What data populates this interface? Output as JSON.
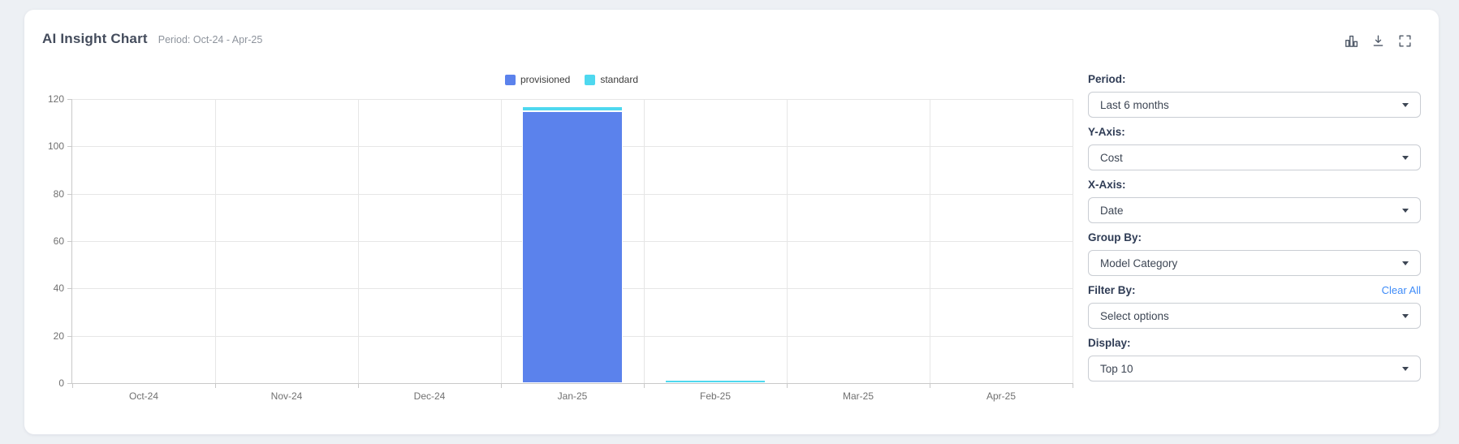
{
  "header": {
    "title": "AI Insight Chart",
    "period": "Period: Oct-24 - Apr-25"
  },
  "toolbar": {
    "icons": [
      "bar-chart-icon",
      "download-icon",
      "fullscreen-icon"
    ]
  },
  "chart_data": {
    "type": "bar",
    "stacked": true,
    "categories": [
      "Oct-24",
      "Nov-24",
      "Dec-24",
      "Jan-25",
      "Feb-25",
      "Mar-25",
      "Apr-25"
    ],
    "series": [
      {
        "name": "provisioned",
        "color": "#5b82ec",
        "values": [
          0,
          0,
          0,
          115,
          0,
          0,
          0
        ]
      },
      {
        "name": "standard",
        "color": "#4ed8ef",
        "values": [
          0,
          0,
          0,
          2,
          1.5,
          0,
          0
        ]
      }
    ],
    "ylim": [
      0,
      120
    ],
    "yticks": [
      0,
      20,
      40,
      60,
      80,
      100,
      120
    ],
    "grid": true,
    "legend_position": "top-center",
    "xlabel": "",
    "ylabel": ""
  },
  "controls": {
    "groups": [
      {
        "id": "period",
        "label": "Period:",
        "value": "Last 6 months"
      },
      {
        "id": "y-axis",
        "label": "Y-Axis:",
        "value": "Cost"
      },
      {
        "id": "x-axis",
        "label": "X-Axis:",
        "value": "Date"
      },
      {
        "id": "group-by",
        "label": "Group By:",
        "value": "Model Category"
      },
      {
        "id": "filter-by",
        "label": "Filter By:",
        "value": "Select options",
        "action": "Clear All"
      },
      {
        "id": "display",
        "label": "Display:",
        "value": "Top 10"
      }
    ]
  },
  "colors": {
    "provisioned": "#5b82ec",
    "standard": "#4ed8ef",
    "link": "#3e8bf8",
    "label_text": "#2f3c55",
    "page_bg": "#edf0f4"
  }
}
